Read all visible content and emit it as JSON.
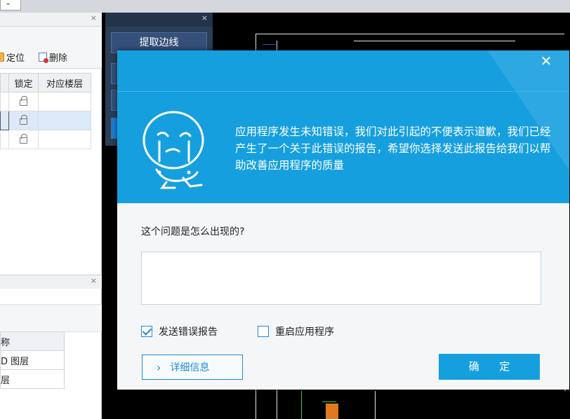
{
  "background": {
    "layers_panel": {
      "toolbar": {
        "locate_label": "定位",
        "delete_label": "删除"
      },
      "columns": [
        "锁定",
        "对应楼层"
      ],
      "rows": [
        {
          "selected": false
        },
        {
          "selected": true
        },
        {
          "selected": false
        }
      ]
    },
    "second_panel": {
      "rows": [
        "称",
        "D 图层",
        "层"
      ]
    },
    "mid_panel": {
      "button_label": "提取边线"
    }
  },
  "dialog": {
    "message": "应用程序发生未知错误，我们对此引起的不便表示道歉，我们已经产生了一个关于此错误的报告，希望你选择发送此报告给我们以帮助改善应用程序的质量",
    "question_label": "这个问题是怎么出现的?",
    "description_value": "",
    "checkbox_send": {
      "label": "发送错误报告",
      "checked": true
    },
    "checkbox_restart": {
      "label": "重启应用程序",
      "checked": false
    },
    "details_button": "详细信息",
    "ok_button": "确 定",
    "accent_color": "#169fdf"
  }
}
